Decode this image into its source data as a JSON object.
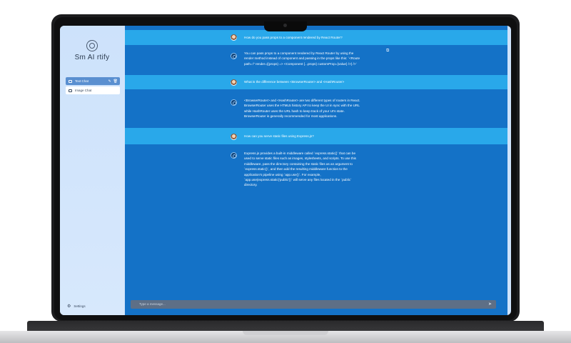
{
  "app": {
    "logo_text": "Sm AI rtify"
  },
  "sidebar": {
    "items": [
      {
        "label": "Text Chat",
        "active": true
      },
      {
        "label": "Image Chat",
        "active": false
      }
    ],
    "settings_label": "Settings"
  },
  "chat": {
    "messages": [
      {
        "role": "user",
        "text": "How do you pass props to a component rendered by React Router?"
      },
      {
        "role": "bot",
        "text": "You can pass props to a component rendered by React Router by using the\nrender method instead of component and passing in the props like this: `<Route\npath='/' render={(props) => <Component {...props} customProp={value} />} />`"
      },
      {
        "role": "user",
        "text": "What is the difference between <BrowserRouter> and <HashRouter>"
      },
      {
        "role": "bot",
        "text": "<BrowserRouter> and <HashRouter> are two different types of routers in React.\nBrowserRouter uses the HTML5 history API to keep the UI in sync with the URL\nwhile HashRouter uses the URL hash to keep track of your UI's state.\nBrowserRouter is generally recommended for most applications."
      },
      {
        "role": "user",
        "text": "How can you serve static files using Express.js?"
      },
      {
        "role": "bot",
        "text": "Express.js provides a built-in middleware called `express.static()` that can be\nused to serve static files such as images, stylesheets, and scripts. To use this\nmiddleware, pass the directory containing the static files as an argument to\n`express.static()`, and then add the resulting middleware function to the\napplication's pipeline using `app.use()`. For example,\n`app.use(express.static('public'))` will serve any files located in the `public`\ndirectory."
      }
    ],
    "input_placeholder": "Type a message..."
  },
  "icons": {
    "collapse": "sidebar-collapse-icon",
    "copy": "copy-icon",
    "send": "send-icon",
    "edit": "pencil-icon",
    "delete": "trash-icon",
    "settings": "gear-icon"
  },
  "colors": {
    "user_row": "#29a8ea",
    "bot_row": "#1472c7",
    "sidebar": "#cfe3fb",
    "active_item": "#5a8fd0"
  }
}
